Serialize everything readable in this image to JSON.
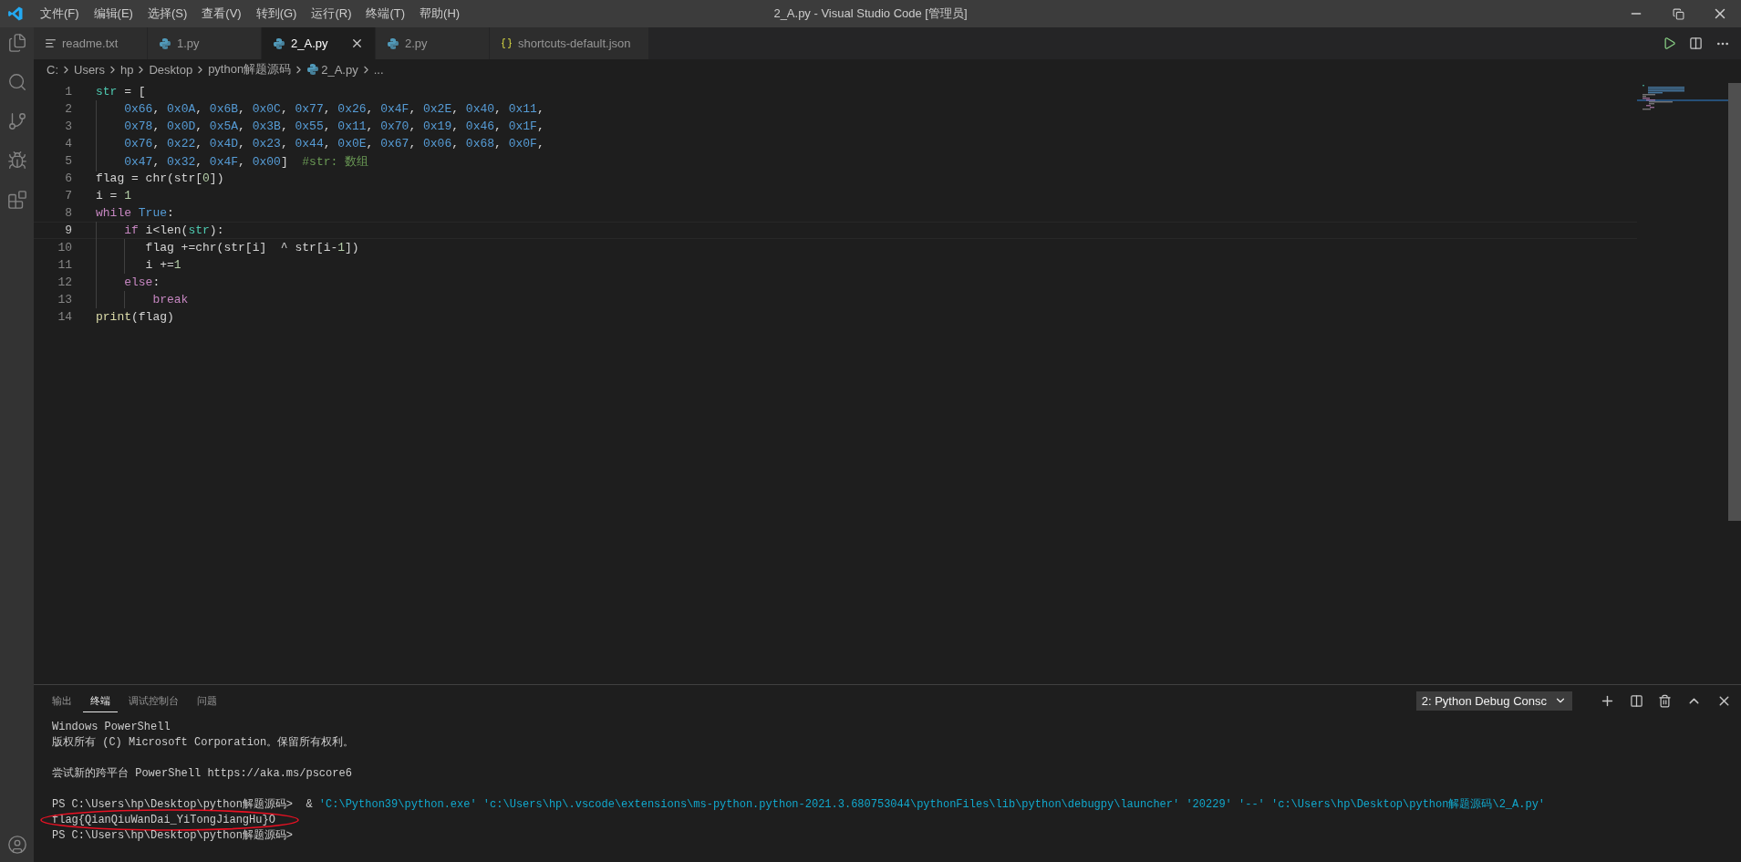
{
  "title_bar": {
    "menus": [
      "文件(F)",
      "编辑(E)",
      "选择(S)",
      "查看(V)",
      "转到(G)",
      "运行(R)",
      "终端(T)",
      "帮助(H)"
    ],
    "title": "2_A.py - Visual Studio Code [管理员]"
  },
  "tabs": [
    {
      "label": "readme.txt",
      "kind": "text",
      "selected": false
    },
    {
      "label": "1.py",
      "kind": "python",
      "selected": false
    },
    {
      "label": "2_A.py",
      "kind": "python",
      "selected": true
    },
    {
      "label": "2.py",
      "kind": "python",
      "selected": false
    },
    {
      "label": "shortcuts-default.json",
      "kind": "json",
      "selected": false
    }
  ],
  "breadcrumb": [
    {
      "label": "C:",
      "kind": "folder"
    },
    {
      "label": "Users",
      "kind": "folder"
    },
    {
      "label": "hp",
      "kind": "folder"
    },
    {
      "label": "Desktop",
      "kind": "folder"
    },
    {
      "label": "python解题源码",
      "kind": "folder"
    },
    {
      "label": "2_A.py",
      "kind": "python"
    },
    {
      "label": "...",
      "kind": "more"
    }
  ],
  "code_lines": [
    {
      "number": "1",
      "current": false,
      "tokens": [
        {
          "text": "str",
          "kind": "type"
        },
        {
          "text": " = [",
          "kind": "plain"
        }
      ]
    },
    {
      "number": "2",
      "current": false,
      "tokens": [
        {
          "text": "    0x66",
          "kind": "hex"
        },
        {
          "text": ", ",
          "kind": "plain"
        },
        {
          "text": "0x0A",
          "kind": "hex"
        },
        {
          "text": ", ",
          "kind": "plain"
        },
        {
          "text": "0x6B",
          "kind": "hex"
        },
        {
          "text": ", ",
          "kind": "plain"
        },
        {
          "text": "0x0C",
          "kind": "hex"
        },
        {
          "text": ", ",
          "kind": "plain"
        },
        {
          "text": "0x77",
          "kind": "hex"
        },
        {
          "text": ", ",
          "kind": "plain"
        },
        {
          "text": "0x26",
          "kind": "hex"
        },
        {
          "text": ", ",
          "kind": "plain"
        },
        {
          "text": "0x4F",
          "kind": "hex"
        },
        {
          "text": ", ",
          "kind": "plain"
        },
        {
          "text": "0x2E",
          "kind": "hex"
        },
        {
          "text": ", ",
          "kind": "plain"
        },
        {
          "text": "0x40",
          "kind": "hex"
        },
        {
          "text": ", ",
          "kind": "plain"
        },
        {
          "text": "0x11",
          "kind": "hex"
        },
        {
          "text": ",",
          "kind": "plain"
        }
      ]
    },
    {
      "number": "3",
      "current": false,
      "tokens": [
        {
          "text": "    0x78",
          "kind": "hex"
        },
        {
          "text": ", ",
          "kind": "plain"
        },
        {
          "text": "0x0D",
          "kind": "hex"
        },
        {
          "text": ", ",
          "kind": "plain"
        },
        {
          "text": "0x5A",
          "kind": "hex"
        },
        {
          "text": ", ",
          "kind": "plain"
        },
        {
          "text": "0x3B",
          "kind": "hex"
        },
        {
          "text": ", ",
          "kind": "plain"
        },
        {
          "text": "0x55",
          "kind": "hex"
        },
        {
          "text": ", ",
          "kind": "plain"
        },
        {
          "text": "0x11",
          "kind": "hex"
        },
        {
          "text": ", ",
          "kind": "plain"
        },
        {
          "text": "0x70",
          "kind": "hex"
        },
        {
          "text": ", ",
          "kind": "plain"
        },
        {
          "text": "0x19",
          "kind": "hex"
        },
        {
          "text": ", ",
          "kind": "plain"
        },
        {
          "text": "0x46",
          "kind": "hex"
        },
        {
          "text": ", ",
          "kind": "plain"
        },
        {
          "text": "0x1F",
          "kind": "hex"
        },
        {
          "text": ",",
          "kind": "plain"
        }
      ]
    },
    {
      "number": "4",
      "current": false,
      "tokens": [
        {
          "text": "    0x76",
          "kind": "hex"
        },
        {
          "text": ", ",
          "kind": "plain"
        },
        {
          "text": "0x22",
          "kind": "hex"
        },
        {
          "text": ", ",
          "kind": "plain"
        },
        {
          "text": "0x4D",
          "kind": "hex"
        },
        {
          "text": ", ",
          "kind": "plain"
        },
        {
          "text": "0x23",
          "kind": "hex"
        },
        {
          "text": ", ",
          "kind": "plain"
        },
        {
          "text": "0x44",
          "kind": "hex"
        },
        {
          "text": ", ",
          "kind": "plain"
        },
        {
          "text": "0x0E",
          "kind": "hex"
        },
        {
          "text": ", ",
          "kind": "plain"
        },
        {
          "text": "0x67",
          "kind": "hex"
        },
        {
          "text": ", ",
          "kind": "plain"
        },
        {
          "text": "0x06",
          "kind": "hex"
        },
        {
          "text": ", ",
          "kind": "plain"
        },
        {
          "text": "0x68",
          "kind": "hex"
        },
        {
          "text": ", ",
          "kind": "plain"
        },
        {
          "text": "0x0F",
          "kind": "hex"
        },
        {
          "text": ",",
          "kind": "plain"
        }
      ]
    },
    {
      "number": "5",
      "current": false,
      "tokens": [
        {
          "text": "    0x47",
          "kind": "hex"
        },
        {
          "text": ", ",
          "kind": "plain"
        },
        {
          "text": "0x32",
          "kind": "hex"
        },
        {
          "text": ", ",
          "kind": "plain"
        },
        {
          "text": "0x4F",
          "kind": "hex"
        },
        {
          "text": ", ",
          "kind": "plain"
        },
        {
          "text": "0x00",
          "kind": "hex"
        },
        {
          "text": "]  ",
          "kind": "plain"
        },
        {
          "text": "#str: 数组",
          "kind": "comment"
        }
      ]
    },
    {
      "number": "6",
      "current": false,
      "tokens": [
        {
          "text": "flag = chr(str[",
          "kind": "plain"
        },
        {
          "text": "0",
          "kind": "num"
        },
        {
          "text": "])",
          "kind": "plain"
        }
      ]
    },
    {
      "number": "7",
      "current": false,
      "tokens": [
        {
          "text": "i = ",
          "kind": "plain"
        },
        {
          "text": "1",
          "kind": "num"
        }
      ]
    },
    {
      "number": "8",
      "current": false,
      "tokens": [
        {
          "text": "while",
          "kind": "kw"
        },
        {
          "text": " True",
          "kind": "const"
        },
        {
          "text": ":",
          "kind": "plain"
        }
      ]
    },
    {
      "number": "9",
      "current": true,
      "tokens": [
        {
          "text": "    if",
          "kind": "kw"
        },
        {
          "text": " i<len(",
          "kind": "plain"
        },
        {
          "text": "str",
          "kind": "type"
        },
        {
          "text": "):",
          "kind": "plain"
        }
      ]
    },
    {
      "number": "10",
      "current": false,
      "tokens": [
        {
          "text": "       flag +=chr(str[i]  ^ str[i-",
          "kind": "plain"
        },
        {
          "text": "1",
          "kind": "num"
        },
        {
          "text": "])",
          "kind": "plain"
        }
      ]
    },
    {
      "number": "11",
      "current": false,
      "tokens": [
        {
          "text": "       i +=",
          "kind": "plain"
        },
        {
          "text": "1",
          "kind": "num"
        }
      ]
    },
    {
      "number": "12",
      "current": false,
      "tokens": [
        {
          "text": "    else",
          "kind": "kw"
        },
        {
          "text": ":",
          "kind": "plain"
        }
      ]
    },
    {
      "number": "13",
      "current": false,
      "tokens": [
        {
          "text": "        break",
          "kind": "kw"
        }
      ]
    },
    {
      "number": "14",
      "current": false,
      "tokens": [
        {
          "text": "print",
          "kind": "fn"
        },
        {
          "text": "(flag)",
          "kind": "plain"
        }
      ]
    }
  ],
  "panel": {
    "tabs": [
      {
        "label": "输出",
        "selected": false
      },
      {
        "label": "终端",
        "selected": true
      },
      {
        "label": "调试控制台",
        "selected": false
      },
      {
        "label": "问题",
        "selected": false
      }
    ],
    "terminal_select": "2: Python Debug Consc",
    "terminal_lines": [
      {
        "gap_before": false,
        "annotated": false,
        "segments": [
          {
            "text": "Windows PowerShell",
            "kind": "text"
          }
        ]
      },
      {
        "gap_before": false,
        "annotated": false,
        "segments": [
          {
            "text": "版权所有 (C) Microsoft Corporation。保留所有权利。",
            "kind": "text"
          }
        ]
      },
      {
        "gap_before": true,
        "annotated": false,
        "segments": [
          {
            "text": "尝试新的跨平台 PowerShell https://aka.ms/pscore6",
            "kind": "text"
          }
        ]
      },
      {
        "gap_before": true,
        "annotated": false,
        "segments": [
          {
            "text": "PS C:\\Users\\hp\\Desktop\\python解题源码>  & ",
            "kind": "text"
          },
          {
            "text": "'C:\\Python39\\python.exe' 'c:\\Users\\hp\\.vscode\\extensions\\ms-python.python-2021.3.680753044\\pythonFiles\\lib\\python\\debugpy\\launcher' '20229' '--' 'c:\\Users\\hp\\Desktop\\python解题源码\\2_A.py'",
            "kind": "command"
          }
        ]
      },
      {
        "gap_before": false,
        "annotated": true,
        "segments": [
          {
            "text": "flag{QianQiuWanDai_YiTongJiangHu}O",
            "kind": "text"
          }
        ]
      },
      {
        "gap_before": false,
        "annotated": false,
        "segments": [
          {
            "text": "PS C:\\Users\\hp\\Desktop\\python解题源码>",
            "kind": "text"
          }
        ]
      }
    ]
  }
}
